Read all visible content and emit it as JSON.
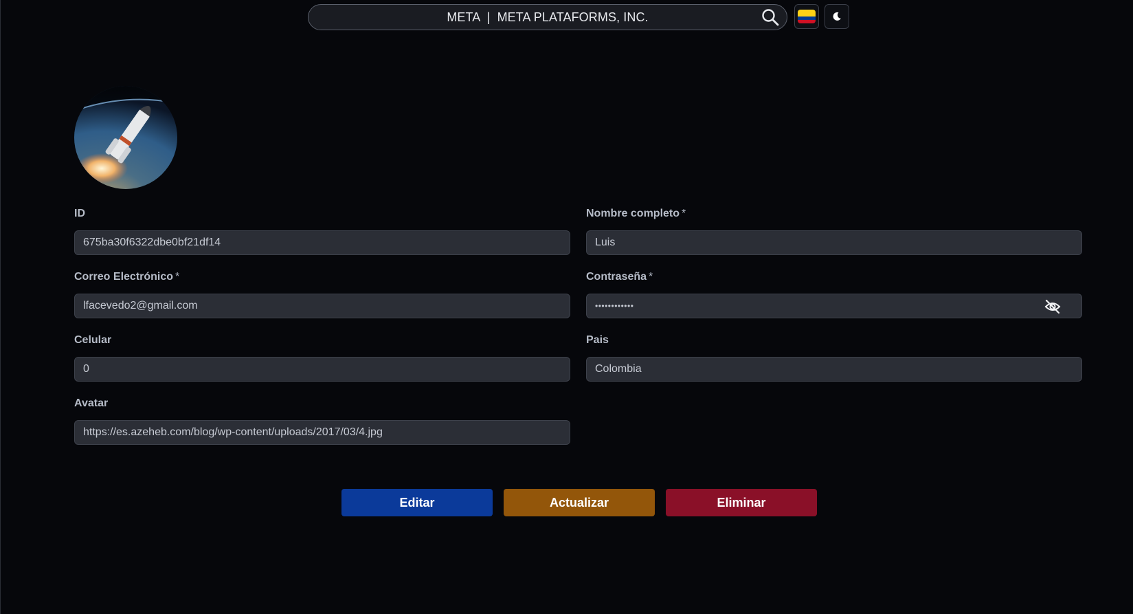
{
  "header": {
    "search_text": "META  |  META PLATAFORMS, INC.",
    "flag_colors": [
      "#FCD116",
      "#003893",
      "#CE1126"
    ]
  },
  "form": {
    "id": {
      "label": "ID",
      "value": "675ba30f6322dbe0bf21df14"
    },
    "full_name": {
      "label": "Nombre completo",
      "required": "*",
      "value": "Luis"
    },
    "email": {
      "label": "Correo Electrónico",
      "required": "*",
      "value": "lfacevedo2@gmail.com"
    },
    "password": {
      "label": "Contraseña",
      "required": "*",
      "value": "••••••••••••"
    },
    "phone": {
      "label": "Celular",
      "value": "0"
    },
    "country": {
      "label": "Pais",
      "value": "Colombia"
    },
    "avatar": {
      "label": "Avatar",
      "value": "https://es.azeheb.com/blog/wp-content/uploads/2017/03/4.jpg"
    }
  },
  "actions": {
    "edit_label": "Editar",
    "update_label": "Actualizar",
    "delete_label": "Eliminar"
  },
  "colors": {
    "background": "#06070b",
    "edit": "#0b3a9a",
    "update": "#93560a",
    "delete": "#8a1028"
  }
}
